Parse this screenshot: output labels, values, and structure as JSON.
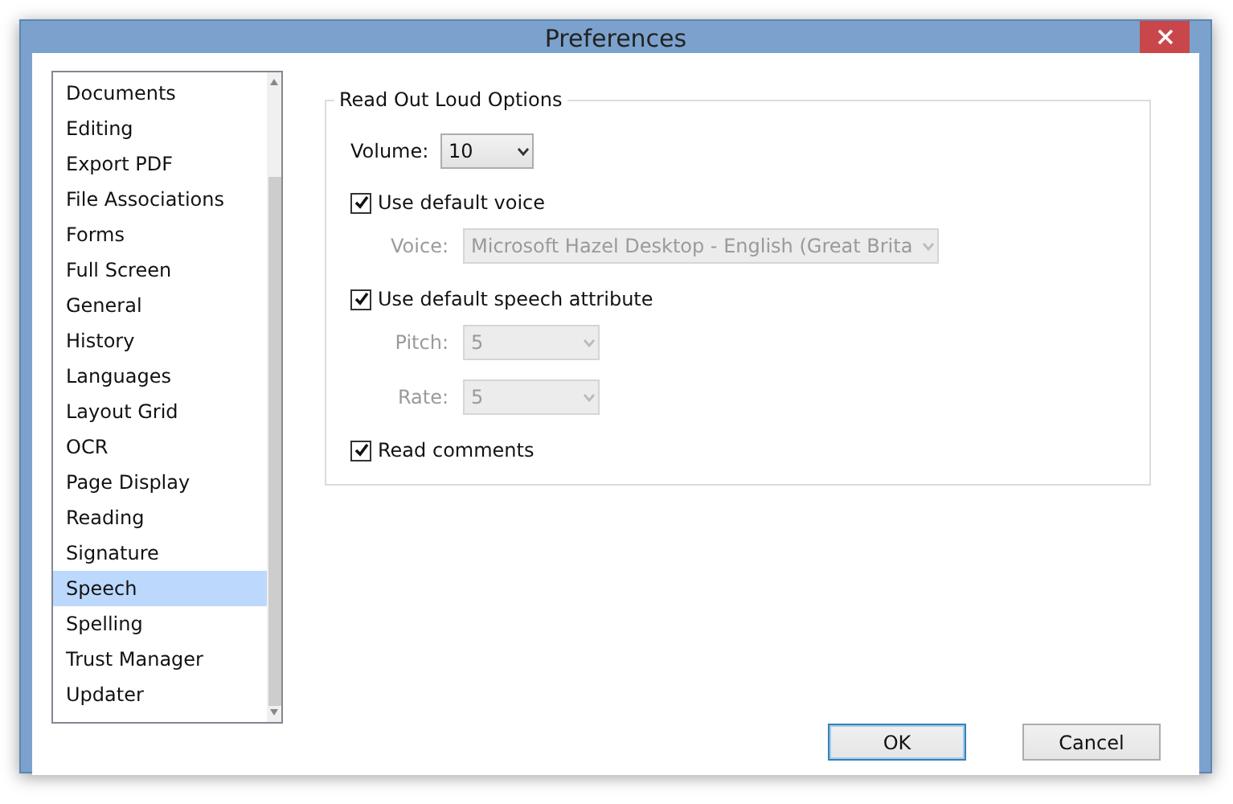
{
  "window": {
    "title": "Preferences"
  },
  "categories": [
    {
      "label": "Documents",
      "selected": false
    },
    {
      "label": "Editing",
      "selected": false
    },
    {
      "label": "Export PDF",
      "selected": false
    },
    {
      "label": "File Associations",
      "selected": false
    },
    {
      "label": "Forms",
      "selected": false
    },
    {
      "label": "Full Screen",
      "selected": false
    },
    {
      "label": "General",
      "selected": false
    },
    {
      "label": "History",
      "selected": false
    },
    {
      "label": "Languages",
      "selected": false
    },
    {
      "label": "Layout Grid",
      "selected": false
    },
    {
      "label": "OCR",
      "selected": false
    },
    {
      "label": "Page Display",
      "selected": false
    },
    {
      "label": "Reading",
      "selected": false
    },
    {
      "label": "Signature",
      "selected": false
    },
    {
      "label": "Speech",
      "selected": true
    },
    {
      "label": "Spelling",
      "selected": false
    },
    {
      "label": "Trust Manager",
      "selected": false
    },
    {
      "label": "Updater",
      "selected": false
    }
  ],
  "group": {
    "title": "Read Out Loud Options",
    "options": [
      {
        "kind": "select",
        "label": "Volume:",
        "value": "10",
        "disabled": false
      },
      {
        "kind": "checkbox",
        "label": "Use default voice",
        "checked": true,
        "children": [
          {
            "kind": "select",
            "label": "Voice:",
            "value": "Microsoft Hazel Desktop - English (Great Brita",
            "disabled": true
          }
        ]
      },
      {
        "kind": "checkbox",
        "label": "Use default speech attribute",
        "checked": true,
        "children": [
          {
            "kind": "select",
            "label": "Pitch:",
            "value": "5",
            "disabled": true
          },
          {
            "kind": "select",
            "label": "Rate:",
            "value": "5",
            "disabled": true
          }
        ]
      },
      {
        "kind": "checkbox",
        "label": "Read comments",
        "checked": true
      }
    ]
  },
  "buttons": [
    {
      "label": "OK",
      "default": true
    },
    {
      "label": "Cancel",
      "default": false
    }
  ]
}
